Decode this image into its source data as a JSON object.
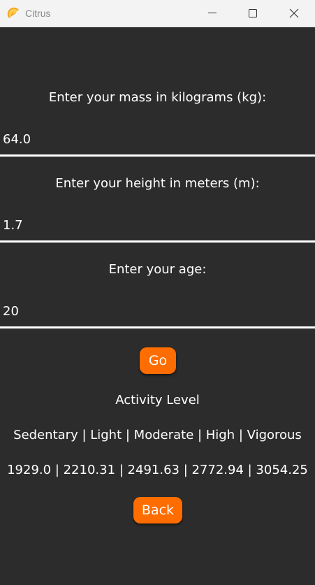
{
  "window": {
    "title": "Citrus",
    "icon": "citrus-slice-icon",
    "controls": {
      "minimize_icon": "minimize-icon",
      "maximize_icon": "maximize-icon",
      "close_icon": "close-icon"
    }
  },
  "form": {
    "mass": {
      "label": "Enter your mass in kilograms (kg):",
      "value": "64.0"
    },
    "height": {
      "label": "Enter your height in meters (m):",
      "value": "1.7"
    },
    "age": {
      "label": "Enter your age:",
      "value": "20"
    }
  },
  "buttons": {
    "go_label": "Go",
    "back_label": "Back"
  },
  "results": {
    "heading": "Activity Level",
    "levels_line": "Sedentary | Light | Moderate | High | Vigorous",
    "values_line": "1929.0 | 2210.31 | 2491.63 | 2772.94 | 3054.25"
  },
  "colors": {
    "background": "#2c2c2c",
    "accent": "#ff6d00",
    "text": "#ffffff",
    "titlebar": "#f3f3f3"
  }
}
